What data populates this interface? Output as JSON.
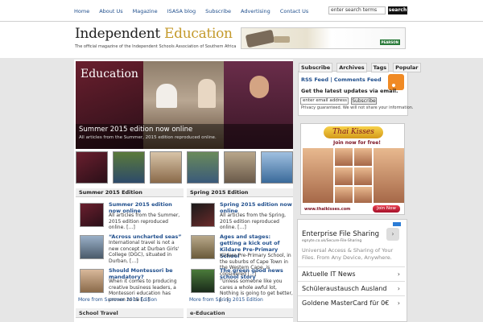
{
  "nav": {
    "items": [
      "Home",
      "About Us",
      "Magazine",
      "ISASA blog",
      "Subscribe",
      "Advertising",
      "Contact Us"
    ],
    "search_placeholder": "enter search terms",
    "search_button": "search"
  },
  "header": {
    "logo_part1": "Independent",
    "logo_part2": "Education",
    "tagline": "The official magazine of the Independent Schools Association of Southern Africa",
    "ad_badge": "PEARSON"
  },
  "slider": {
    "image_title": "Education",
    "title": "Summer 2015 edition now online",
    "subtitle": "All articles from the Summer, 2015 edition reproduced online."
  },
  "left_section": {
    "title": "Summer 2015 Edition",
    "articles": [
      {
        "title": "Summer 2015 edition now online",
        "excerpt": "All articles from the Summer, 2015 edition reproduced online. […]"
      },
      {
        "title": "“Across uncharted seas”",
        "excerpt": "International travel is not a new concept at Durban Girls' College (DGC), situated in Durban, […]"
      },
      {
        "title": "Should Montessori be mandatory?",
        "excerpt": "When it comes to producing creative business leaders, a Montessori education has proven to be […]"
      }
    ],
    "more": "More from Summer 2015 Edition"
  },
  "right_section": {
    "title": "Spring 2015 Edition",
    "articles": [
      {
        "title": "Spring 2015 edition now online",
        "excerpt": "All articles from the Spring, 2015 edition reproduced online. […]"
      },
      {
        "title": "Ages and stages: getting a kick out of Kildare Pre-Primary School",
        "excerpt": "Kildare Pre-Primary School, in the suburbs of Cape Town in the Western Cape, is considered […]"
      },
      {
        "title": "The green good news school story",
        "excerpt": "“Unless someone like you cares a whole awful lot, Nothing is going to get better, […]"
      }
    ],
    "more": "More from Spring 2015 Edition"
  },
  "bottom_sections": [
    "School Travel",
    "e-Education"
  ],
  "sidebar": {
    "tabs": [
      "Subscribe",
      "Archives",
      "Tags",
      "Popular"
    ],
    "rss_feed": "RSS Feed",
    "separator": "|",
    "comments_feed": "Comments Feed",
    "latest_heading": "Get the latest updates via email.",
    "email_placeholder": "enter email address",
    "subscribe_button": "Subscribe",
    "privacy": "Privacy guaranteed. We will not share your information.",
    "ad_header": "Thai Kisses",
    "ad_sub": "Join now for free!",
    "ad_url": "www.thaikisses.com",
    "ad_join": "Join Now",
    "google_ad": {
      "title": "Enterprise File Sharing",
      "url": "egnyte.co.uk/Secure-File-Sharing",
      "text": "Universal Access & Sharing of Your Files. From Any Device, Anywhere.",
      "links": [
        "Aktuelle IT News",
        "Schüleraustausch Ausland",
        "Goldene MasterCard für 0€"
      ]
    }
  },
  "colors": {
    "link": "#1f4e8c",
    "accent": "#c49a2c",
    "rss": "#f08a24"
  }
}
